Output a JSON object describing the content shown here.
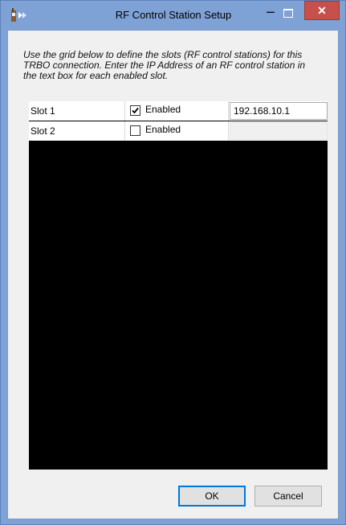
{
  "window": {
    "title": "RF Control Station Setup",
    "minimize_glyph": "−",
    "close_glyph": "✕",
    "app_icon": "radio-icon",
    "colors": {
      "frame": "#7ea2d6",
      "close": "#c7504a",
      "grid": "#000000"
    }
  },
  "instructions": "Use the grid below to define the slots (RF control stations) for this TRBO connection.  Enter the IP Address of an RF control station in the text box for each enabled slot.",
  "grid": {
    "rows": [
      {
        "slot": "Slot 1",
        "enabled_label": "Enabled",
        "enabled": true,
        "ip": "192.168.10.1"
      },
      {
        "slot": "Slot 2",
        "enabled_label": "Enabled",
        "enabled": false,
        "ip": ""
      }
    ]
  },
  "buttons": {
    "ok": "OK",
    "cancel": "Cancel"
  }
}
